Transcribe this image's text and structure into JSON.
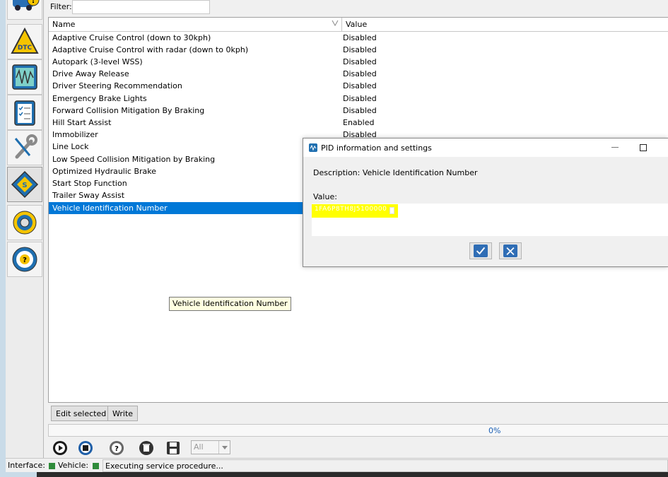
{
  "sidebar": {
    "icons": [
      "car-warning-icon",
      "dtc-icon",
      "oscilloscope-icon",
      "checklist-icon",
      "wrench-icon",
      "chip-icon",
      "gear-icon",
      "steering-help-icon"
    ]
  },
  "filter": {
    "label": "Filter:",
    "value": ""
  },
  "table": {
    "columns": {
      "name": "Name",
      "value": "Value"
    },
    "rows": [
      {
        "name": "Adaptive Cruise Control (down to 30kph)",
        "value": "Disabled"
      },
      {
        "name": "Adaptive Cruise Control with radar (down to 0kph)",
        "value": "Disabled"
      },
      {
        "name": "Autopark (3-level WSS)",
        "value": "Disabled"
      },
      {
        "name": "Drive Away Release",
        "value": "Disabled"
      },
      {
        "name": "Driver Steering Recommendation",
        "value": "Disabled"
      },
      {
        "name": "Emergency Brake Lights",
        "value": "Disabled"
      },
      {
        "name": "Forward Collision Mitigation By Braking",
        "value": "Disabled"
      },
      {
        "name": "Hill Start Assist",
        "value": "Enabled"
      },
      {
        "name": "Immobilizer",
        "value": "Disabled"
      },
      {
        "name": "Line Lock",
        "value": ""
      },
      {
        "name": "Low Speed Collision Mitigation by Braking",
        "value": ""
      },
      {
        "name": "Optimized Hydraulic Brake",
        "value": ""
      },
      {
        "name": "Start Stop Function",
        "value": ""
      },
      {
        "name": "Trailer Sway Assist",
        "value": ""
      },
      {
        "name": "Vehicle Identification Number",
        "value": ""
      }
    ],
    "selected_row": "Vehicle Identification Number"
  },
  "tooltip": "Vehicle Identification Number",
  "buttons": {
    "edit_selected": "Edit selected",
    "write": "Write"
  },
  "progress": {
    "text": "0%",
    "value": 0
  },
  "toolbar": {
    "combo_value": "All"
  },
  "status": {
    "interface_label": "Interface:",
    "vehicle_label": "Vehicle:",
    "message": "Executing service procedure...",
    "ok_color": "#2e8b3a"
  },
  "dialog": {
    "title": "PID information and settings",
    "description": "Description: Vehicle Identification Number",
    "value_label": "Value:",
    "value": "1FA6P8TH8J5100000",
    "highlight_color": "#ffff00",
    "confirm_color": "#2f6db5",
    "cancel_color": "#2f6db5"
  }
}
